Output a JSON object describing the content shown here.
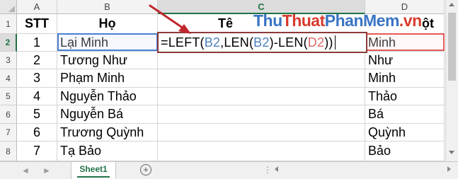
{
  "columns": [
    "A",
    "B",
    "C",
    "D"
  ],
  "rows": [
    "1",
    "2",
    "3",
    "4",
    "5",
    "6",
    "7",
    "8"
  ],
  "header": {
    "stt": "STT",
    "ho": "Họ",
    "ten_partial": "Tê",
    "d_partial": "ột"
  },
  "data": [
    {
      "stt": "1",
      "ho": "Lại Minh",
      "d": "Minh"
    },
    {
      "stt": "2",
      "ho": "Tương Như",
      "d": "Như"
    },
    {
      "stt": "3",
      "ho": "Phạm Minh",
      "d": "Minh"
    },
    {
      "stt": "4",
      "ho": "Nguyễn Thảo",
      "d": "Thảo"
    },
    {
      "stt": "5",
      "ho": "Nguyễn Bá",
      "d": "Bá"
    },
    {
      "stt": "6",
      "ho": "Trương Quỳnh",
      "d": "Quỳnh"
    },
    {
      "stt": "7",
      "ho": "Tạ Bảo",
      "d": "Bảo"
    }
  ],
  "formula": {
    "p1": "=LEFT(",
    "r1": "B2",
    "p2": ",LEN(",
    "r2": "B2",
    "p3": ")-LEN(",
    "r3": "D2",
    "p4": "))"
  },
  "watermark": {
    "a": "Thu",
    "b": "Thuat",
    "c": "PhanMem",
    "d": ".vn"
  },
  "tabs": {
    "sheet1": "Sheet1",
    "add": "+",
    "nav_prev": "◄",
    "nav_next": "►",
    "more": "⋮"
  },
  "colors": {
    "selected_ref": "#4a7fd4",
    "range_ref": "#e45a5a",
    "accent": "#217346",
    "arrow": "#c0282d"
  }
}
